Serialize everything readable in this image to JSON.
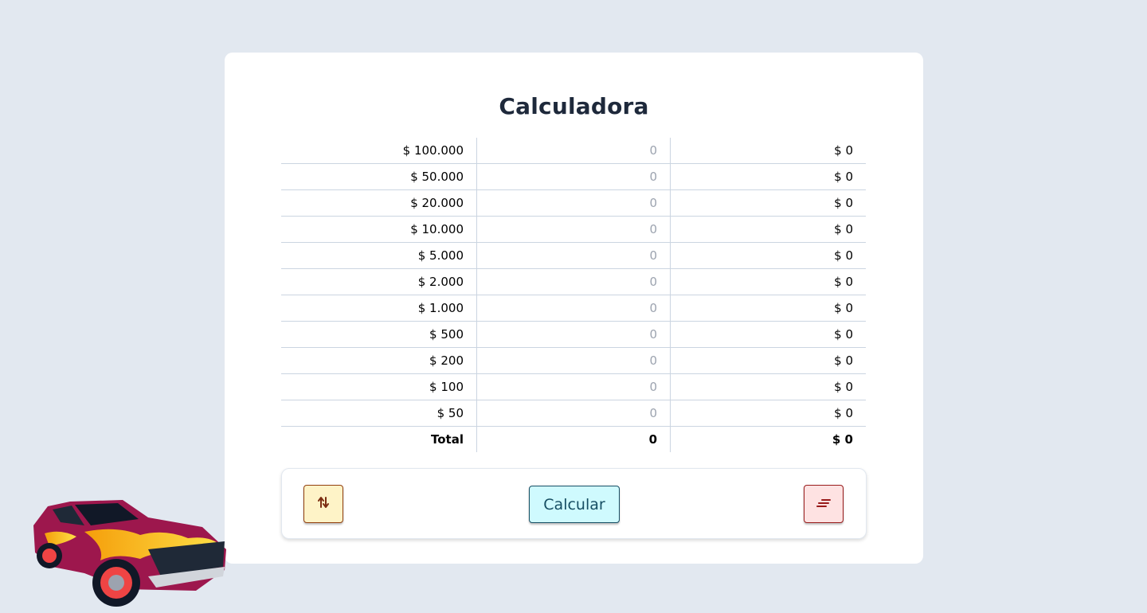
{
  "title": "Calculadora",
  "rows": [
    {
      "denomination": "$ 100.000",
      "count": "0",
      "subtotal": "$ 0"
    },
    {
      "denomination": "$ 50.000",
      "count": "0",
      "subtotal": "$ 0"
    },
    {
      "denomination": "$ 20.000",
      "count": "0",
      "subtotal": "$ 0"
    },
    {
      "denomination": "$ 10.000",
      "count": "0",
      "subtotal": "$ 0"
    },
    {
      "denomination": "$ 5.000",
      "count": "0",
      "subtotal": "$ 0"
    },
    {
      "denomination": "$ 2.000",
      "count": "0",
      "subtotal": "$ 0"
    },
    {
      "denomination": "$ 1.000",
      "count": "0",
      "subtotal": "$ 0"
    },
    {
      "denomination": "$ 500",
      "count": "0",
      "subtotal": "$ 0"
    },
    {
      "denomination": "$ 200",
      "count": "0",
      "subtotal": "$ 0"
    },
    {
      "denomination": "$ 100",
      "count": "0",
      "subtotal": "$ 0"
    },
    {
      "denomination": "$ 50",
      "count": "0",
      "subtotal": "$ 0"
    }
  ],
  "total": {
    "label": "Total",
    "count": "0",
    "amount": "$ 0"
  },
  "actions": {
    "swap_icon": "swap-vertical-icon",
    "calculate_label": "Calcular",
    "clear_icon": "clear-lines-icon"
  },
  "colors": {
    "background": "#e2e8f0",
    "swap_button": "#fef3c7",
    "calculate_button": "#cffafe",
    "clear_button": "#fee2e2"
  }
}
